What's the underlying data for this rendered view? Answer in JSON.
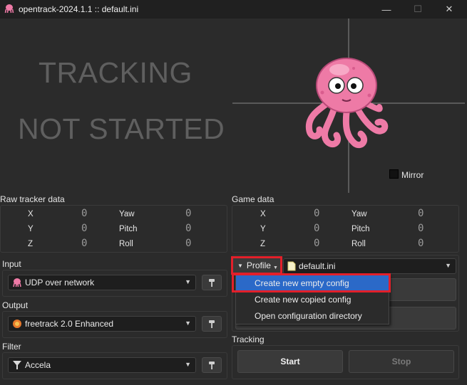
{
  "window": {
    "title": "opentrack-2024.1.1 :: default.ini",
    "minimize": "—",
    "maximize": "☐",
    "close": "✕"
  },
  "status": {
    "line1": "TRACKING",
    "line2": "NOT STARTED"
  },
  "mirror": {
    "label": "Mirror",
    "checked": false
  },
  "raw_tracker": {
    "title": "Raw tracker data",
    "rows": [
      {
        "label_a": "X",
        "value_a": "0",
        "label_b": "Yaw",
        "value_b": "0"
      },
      {
        "label_a": "Y",
        "value_a": "0",
        "label_b": "Pitch",
        "value_b": "0"
      },
      {
        "label_a": "Z",
        "value_a": "0",
        "label_b": "Roll",
        "value_b": "0"
      }
    ]
  },
  "game_data": {
    "title": "Game data",
    "rows": [
      {
        "label_a": "X",
        "value_a": "0",
        "label_b": "Yaw",
        "value_b": "0"
      },
      {
        "label_a": "Y",
        "value_a": "0",
        "label_b": "Pitch",
        "value_b": "0"
      },
      {
        "label_a": "Z",
        "value_a": "0",
        "label_b": "Roll",
        "value_b": "0"
      }
    ]
  },
  "input": {
    "title": "Input",
    "value": "UDP over network"
  },
  "output": {
    "title": "Output",
    "value": "freetrack 2.0 Enhanced"
  },
  "filter": {
    "title": "Filter",
    "value": "Accela"
  },
  "profile": {
    "button_label": "Profile",
    "current": "default.ini",
    "menu": [
      "Create new empty config",
      "Create new copied config",
      "Open configuration directory"
    ]
  },
  "tracking": {
    "title": "Tracking",
    "start": "Start",
    "stop": "Stop"
  },
  "colors": {
    "background": "#2b2b2b",
    "highlight": "#2b69c8",
    "annotation": "#e3202a",
    "mascot": "#ee7aa6"
  }
}
